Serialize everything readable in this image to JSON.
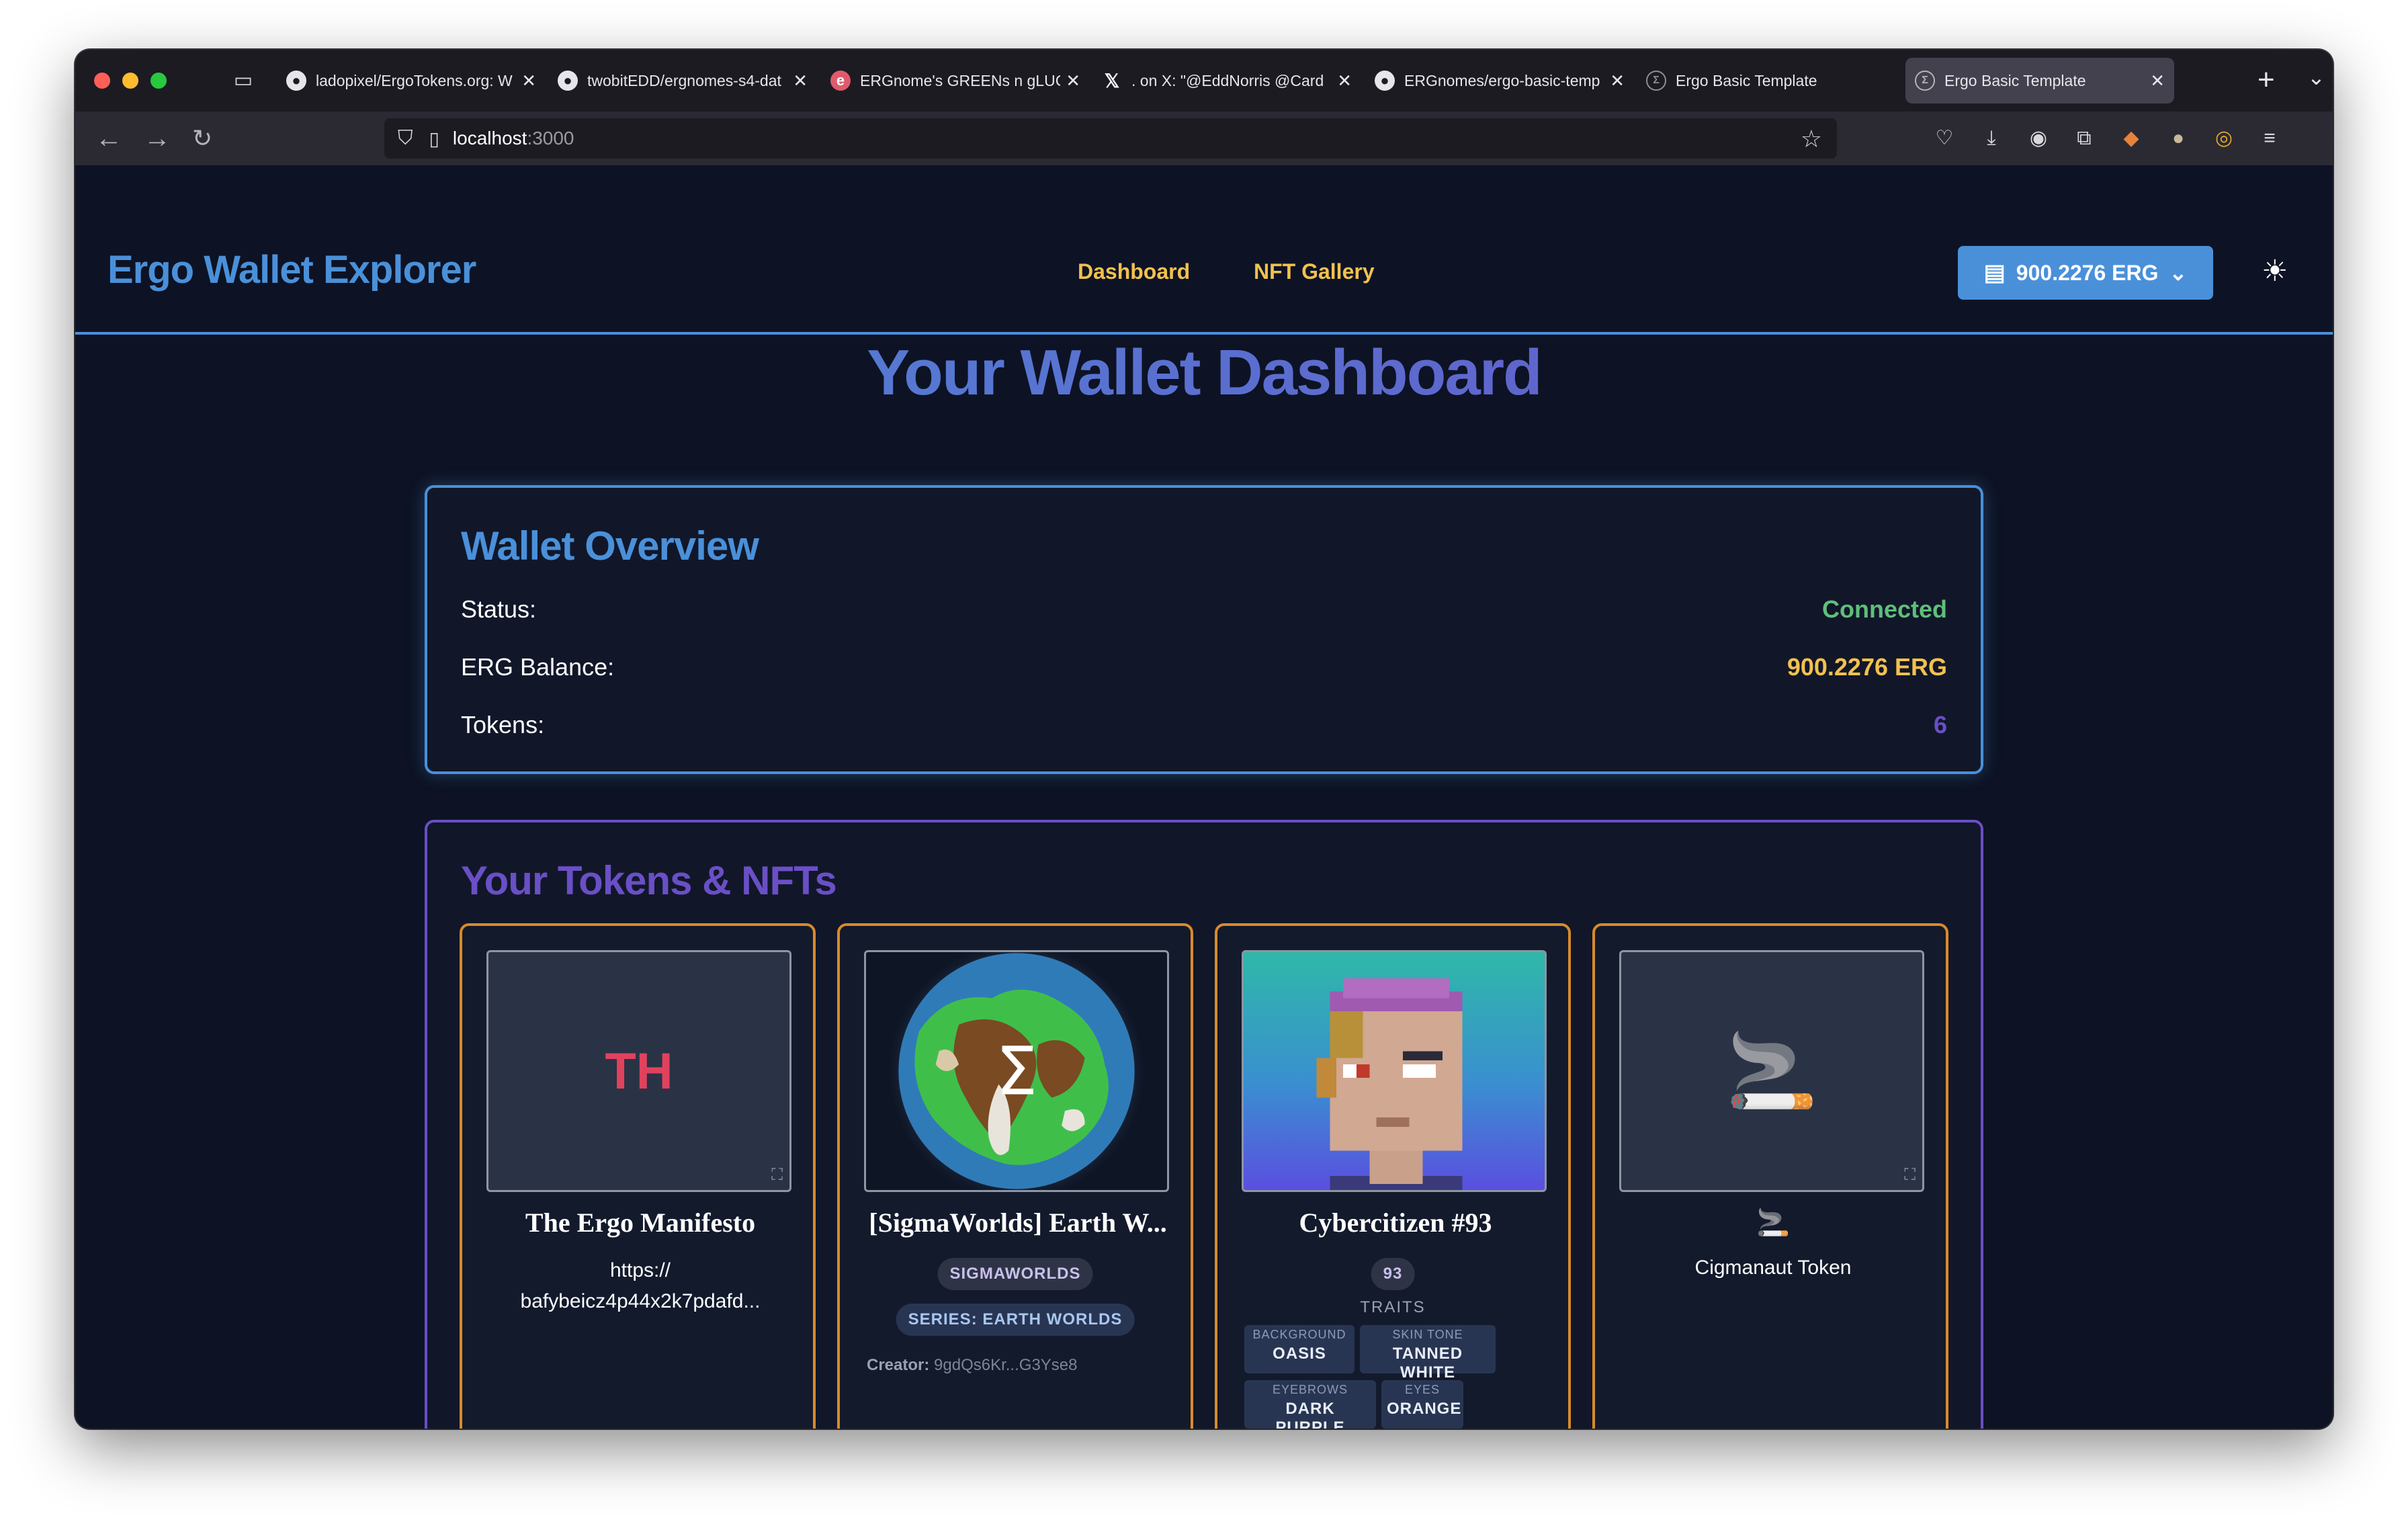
{
  "browser": {
    "tabs": [
      {
        "label": "ladopixel/ErgoTokens.org: W",
        "icon": "github-icon"
      },
      {
        "label": "twobitEDD/ergnomes-s4-dat",
        "icon": "github-icon"
      },
      {
        "label": "ERGnome's GREENs n gLUC",
        "icon": "ergnomes-icon"
      },
      {
        "label": ". on X: \"@EddNorris @Card",
        "icon": "x-icon"
      },
      {
        "label": "ERGnomes/ergo-basic-temp",
        "icon": "github-icon"
      },
      {
        "label": "Ergo Basic Template",
        "icon": "ergo-icon"
      },
      {
        "label": "Ergo Basic Template",
        "icon": "ergo-icon",
        "active": true
      }
    ],
    "url_host": "localhost",
    "url_port": ":3000"
  },
  "header": {
    "brand": "Ergo Wallet Explorer",
    "nav": [
      "Dashboard",
      "NFT Gallery"
    ],
    "wallet_button": "900.2276 ERG",
    "accent": "#4a90d9",
    "nav_color": "#f2c14e"
  },
  "main": {
    "title": "Your Wallet Dashboard",
    "overview": {
      "heading": "Wallet Overview",
      "status_label": "Status:",
      "status_value": "Connected",
      "balance_label": "ERG Balance:",
      "balance_value": "900.2276 ERG",
      "tokens_label": "Tokens:",
      "tokens_value": "6",
      "colors": {
        "connected": "#5fbf7a",
        "balance": "#f2c14e",
        "tokens": "#6a4fc6"
      }
    },
    "tokens": {
      "heading": "Your Tokens & NFTs",
      "cards": [
        {
          "placeholder": "TH",
          "title": "The Ergo Manifesto",
          "desc_line1": "https://",
          "desc_line2": "bafybeicz4p44x2k7pdafd..."
        },
        {
          "image_glyph": "Σ",
          "title": "[SigmaWorlds] Earth W...",
          "tag1": "SIGMAWORLDS",
          "tag2": "SERIES: EARTH WORLDS",
          "creator_label": "Creator:",
          "creator_value": "9gdQs6Kr...G3Yse8"
        },
        {
          "title": "Cybercitizen #93",
          "badge": "93",
          "traits_label": "TRAITS",
          "traits": [
            {
              "key": "BACKGROUND",
              "value": "OASIS"
            },
            {
              "key": "SKIN TONE",
              "value": "TANNED WHITE"
            },
            {
              "key": "EYEBROWS",
              "value": "DARK PURPLE"
            },
            {
              "key": "EYES",
              "value": "ORANGE"
            }
          ]
        },
        {
          "emoji": "🚬",
          "small_emoji": "🚬",
          "title": "Cigmanaut Token"
        }
      ]
    }
  }
}
